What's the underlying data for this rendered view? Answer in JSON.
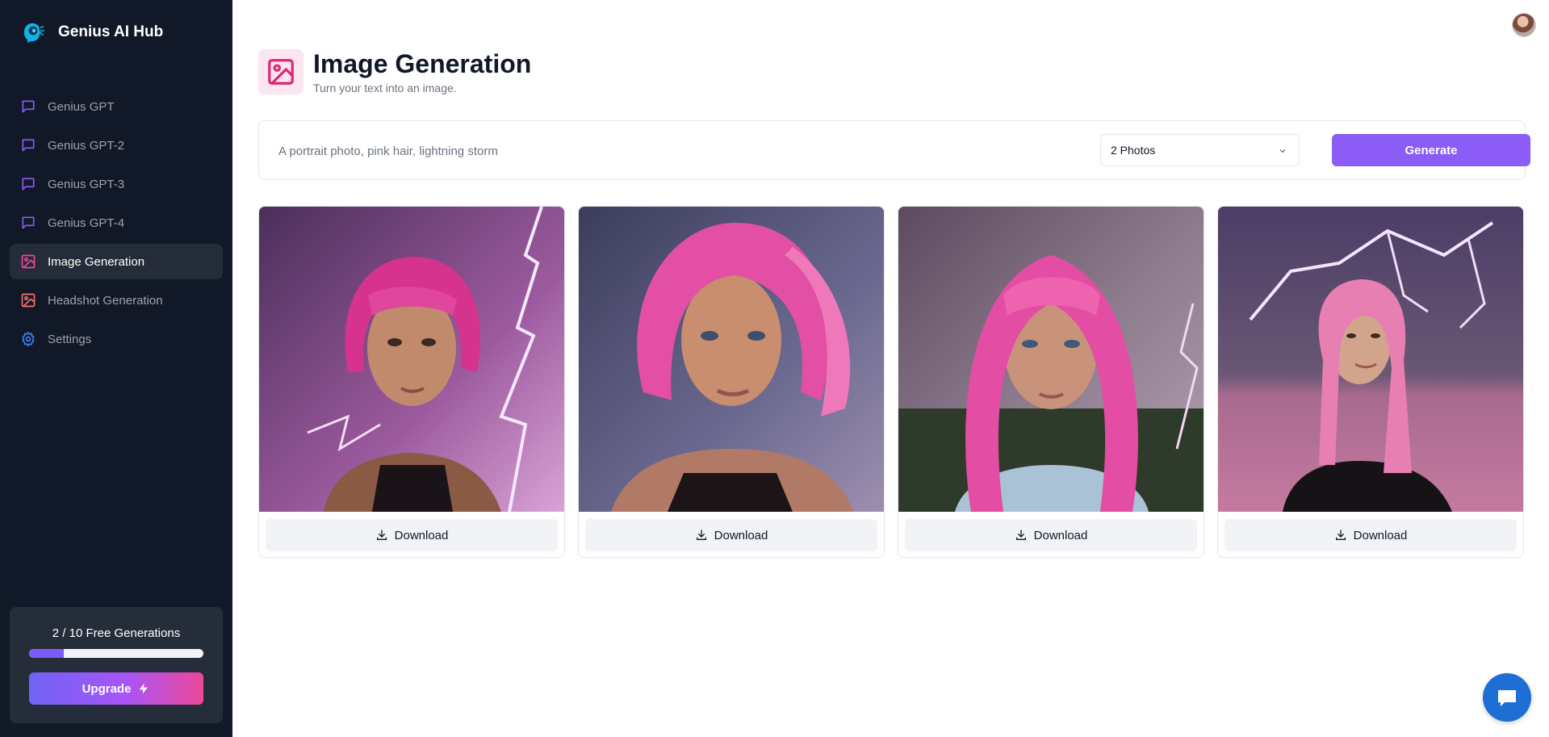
{
  "brand": {
    "name": "Genius AI Hub"
  },
  "sidebar": {
    "items": [
      {
        "label": "Genius GPT",
        "icon": "message-square-icon",
        "color": "#8b5cf6",
        "active": false
      },
      {
        "label": "Genius GPT-2",
        "icon": "message-square-icon",
        "color": "#8b5cf6",
        "active": false
      },
      {
        "label": "Genius GPT-3",
        "icon": "message-square-icon",
        "color": "#8b5cf6",
        "active": false
      },
      {
        "label": "Genius GPT-4",
        "icon": "message-square-icon",
        "color": "#8b5cf6",
        "active": false
      },
      {
        "label": "Image Generation",
        "icon": "image-icon",
        "color": "#ec4899",
        "active": true
      },
      {
        "label": "Headshot Generation",
        "icon": "image-icon",
        "color": "#f87171",
        "active": false
      },
      {
        "label": "Settings",
        "icon": "gear-icon",
        "color": "#3b82f6",
        "active": false
      }
    ]
  },
  "usage": {
    "text": "2 / 10 Free Generations",
    "used": 2,
    "limit": 10,
    "progress_fraction": 0.2,
    "upgrade_label": "Upgrade"
  },
  "header": {
    "title": "Image Generation",
    "subtitle": "Turn your text into an image.",
    "icon": "image-icon",
    "accent_color": "#db2777"
  },
  "form": {
    "prompt_placeholder": "A portrait photo, pink hair, lightning storm",
    "prompt_value": "",
    "amount_selected": "2 Photos",
    "generate_label": "Generate"
  },
  "images": [
    {
      "alt": "portrait-1",
      "download_label": "Download"
    },
    {
      "alt": "portrait-2",
      "download_label": "Download"
    },
    {
      "alt": "portrait-3",
      "download_label": "Download"
    },
    {
      "alt": "portrait-4",
      "download_label": "Download"
    }
  ],
  "colors": {
    "sidebar_bg": "#111827",
    "primary": "#8b5cf6",
    "chat_fab": "#1d6fd6"
  }
}
